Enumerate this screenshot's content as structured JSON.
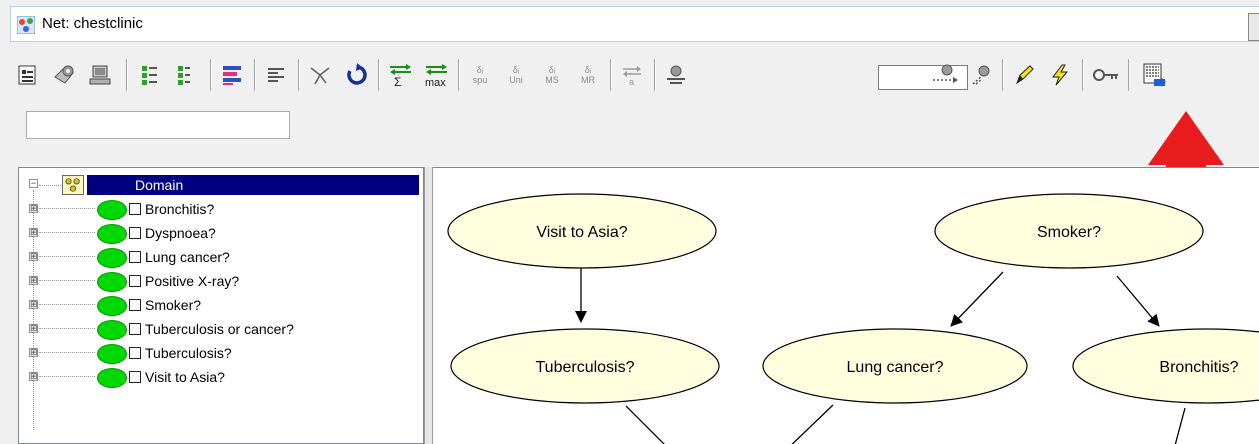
{
  "window": {
    "title": "Net: chestclinic"
  },
  "toolbar": {
    "delta_labels": [
      {
        "top": "δᵢ",
        "bottom": "spu"
      },
      {
        "top": "δᵢ",
        "bottom": "Uni"
      },
      {
        "top": "δᵢ",
        "bottom": "MS"
      },
      {
        "top": "δᵢ",
        "bottom": "MR"
      }
    ],
    "sum_label": "Σ",
    "max_label": "max",
    "evidence_value": "",
    "search_value": ""
  },
  "tree": {
    "root_label": "Domain",
    "expander_symbol": "⊞",
    "items": [
      {
        "label": "Bronchitis?"
      },
      {
        "label": "Dyspnoea?"
      },
      {
        "label": "Lung cancer?"
      },
      {
        "label": "Positive X-ray?"
      },
      {
        "label": "Smoker?"
      },
      {
        "label": "Tuberculosis or cancer?"
      },
      {
        "label": "Tuberculosis?"
      },
      {
        "label": "Visit to Asia?"
      }
    ]
  },
  "graph": {
    "nodes": [
      {
        "label": "Visit to Asia?"
      },
      {
        "label": "Smoker?"
      },
      {
        "label": "Tuberculosis?"
      },
      {
        "label": "Lung cancer?"
      },
      {
        "label": "Bronchitis?"
      }
    ]
  },
  "colors": {
    "node_fill": "#ffffe0",
    "node_dot": "#00d800",
    "selection": "#000080",
    "highlight_arrow": "#e81c1c"
  }
}
